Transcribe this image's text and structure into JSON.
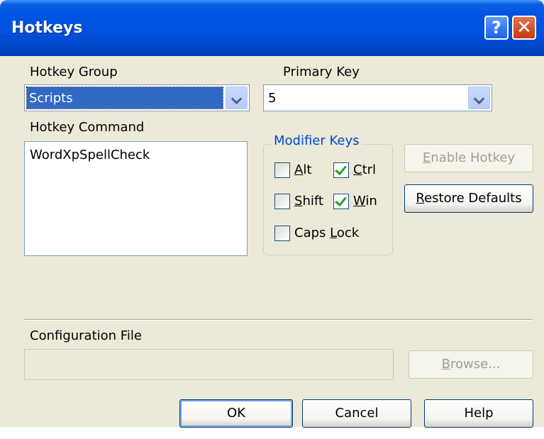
{
  "window": {
    "title": "Hotkeys"
  },
  "titlebar_buttons": {
    "help": "?",
    "close": "✕"
  },
  "hotkey_group": {
    "label": "Hotkey Group",
    "value": "Scripts"
  },
  "primary_key": {
    "label": "Primary Key",
    "value": "5"
  },
  "hotkey_command": {
    "label": "Hotkey Command",
    "items": [
      "WordXpSpellCheck"
    ]
  },
  "modifier_keys": {
    "title": "Modifier Keys",
    "alt": {
      "mn": "A",
      "rest": "lt",
      "checked": false
    },
    "ctrl": {
      "mn": "C",
      "rest": "trl",
      "checked": true
    },
    "shift": {
      "mn": "S",
      "rest": "hift",
      "checked": false
    },
    "win": {
      "mn": "W",
      "rest": "in",
      "checked": true
    },
    "capslock": {
      "pre": "Caps ",
      "mn": "L",
      "rest": "ock",
      "checked": false
    }
  },
  "buttons": {
    "enable_hotkey": {
      "mn": "E",
      "rest": "nable Hotkey"
    },
    "restore_defaults": {
      "mn": "R",
      "rest": "estore Defaults"
    },
    "browse": {
      "mn": "B",
      "rest": "rowse..."
    },
    "ok": "OK",
    "cancel": "Cancel",
    "help": "Help"
  },
  "config_file": {
    "label": "Configuration File",
    "value": ""
  },
  "colors": {
    "titlebar": "#0054e3",
    "dialog_bg": "#ece9d8",
    "group_title": "#0046d5",
    "selection": "#316ac5",
    "check": "#21a121"
  },
  "icons": {
    "help": "help-icon",
    "close": "close-icon",
    "dropdown": "chevron-down-icon",
    "check": "checkmark-icon"
  }
}
